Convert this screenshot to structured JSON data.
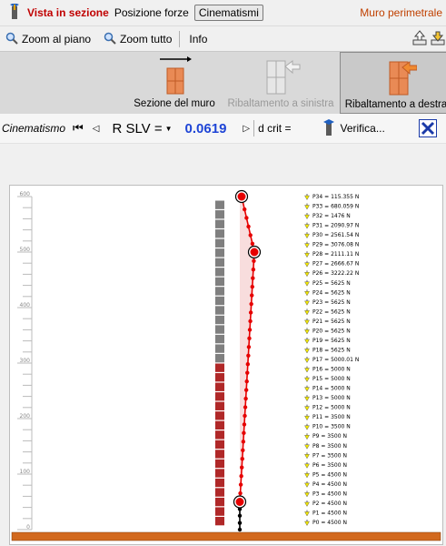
{
  "tabs": {
    "vista": "Vista in sezione",
    "posizione": "Posizione forze",
    "cinematismi": "Cinematismi",
    "title": "Muro perimetrale"
  },
  "toolbar": {
    "zoom_piano": "Zoom al piano",
    "zoom_tutto": "Zoom tutto",
    "info": "Info"
  },
  "ribbon": {
    "sezione": "Sezione del muro",
    "ribalt_sx": "Ribaltamento a sinistra",
    "ribalt_dx": "Ribaltamento a destra"
  },
  "cine": {
    "label": "Cinematismo",
    "combo": "R SLV =",
    "value": "0.0619",
    "dcrit": "d crit =",
    "verifica": "Verifica..."
  },
  "colors": {
    "red": "#e60000",
    "brick": "#b02828",
    "gray": "#7f7f7f",
    "ground": "#d2691e"
  },
  "axis": {
    "ymin": 0,
    "ymax": 600,
    "ticks": [
      "0",
      "100",
      "200",
      "300",
      "400",
      "500",
      "600"
    ]
  },
  "loads": [
    "P34 = 115.355 N",
    "P33 = 680.059 N",
    "P32 = 1476 N",
    "P31 = 2090.97 N",
    "P30 = 2561.54 N",
    "P29 = 3076.08 N",
    "P28 = 2111.11 N",
    "P27 = 2666.67 N",
    "P26 = 3222.22 N",
    "P25 = 5625 N",
    "P24 = 5625 N",
    "P23 = 5625 N",
    "P22 = 5625 N",
    "P21 = 5625 N",
    "P20 = 5625 N",
    "P19 = 5625 N",
    "P18 = 5625 N",
    "P17 = 5000.01 N",
    "P16 = 5000 N",
    "P15 = 5000 N",
    "P14 = 5000 N",
    "P13 = 5000 N",
    "P12 = 5000 N",
    "P11 = 3500 N",
    "P10 = 3500 N",
    "P9 = 3500 N",
    "P8 = 3500 N",
    "P7 = 3500 N",
    "P6 = 3500 N",
    "P5 = 4500 N",
    "P4 = 4500 N",
    "P3 = 4500 N",
    "P2 = 4500 N",
    "P1 = 4500 N",
    "P0 = 4500 N"
  ]
}
